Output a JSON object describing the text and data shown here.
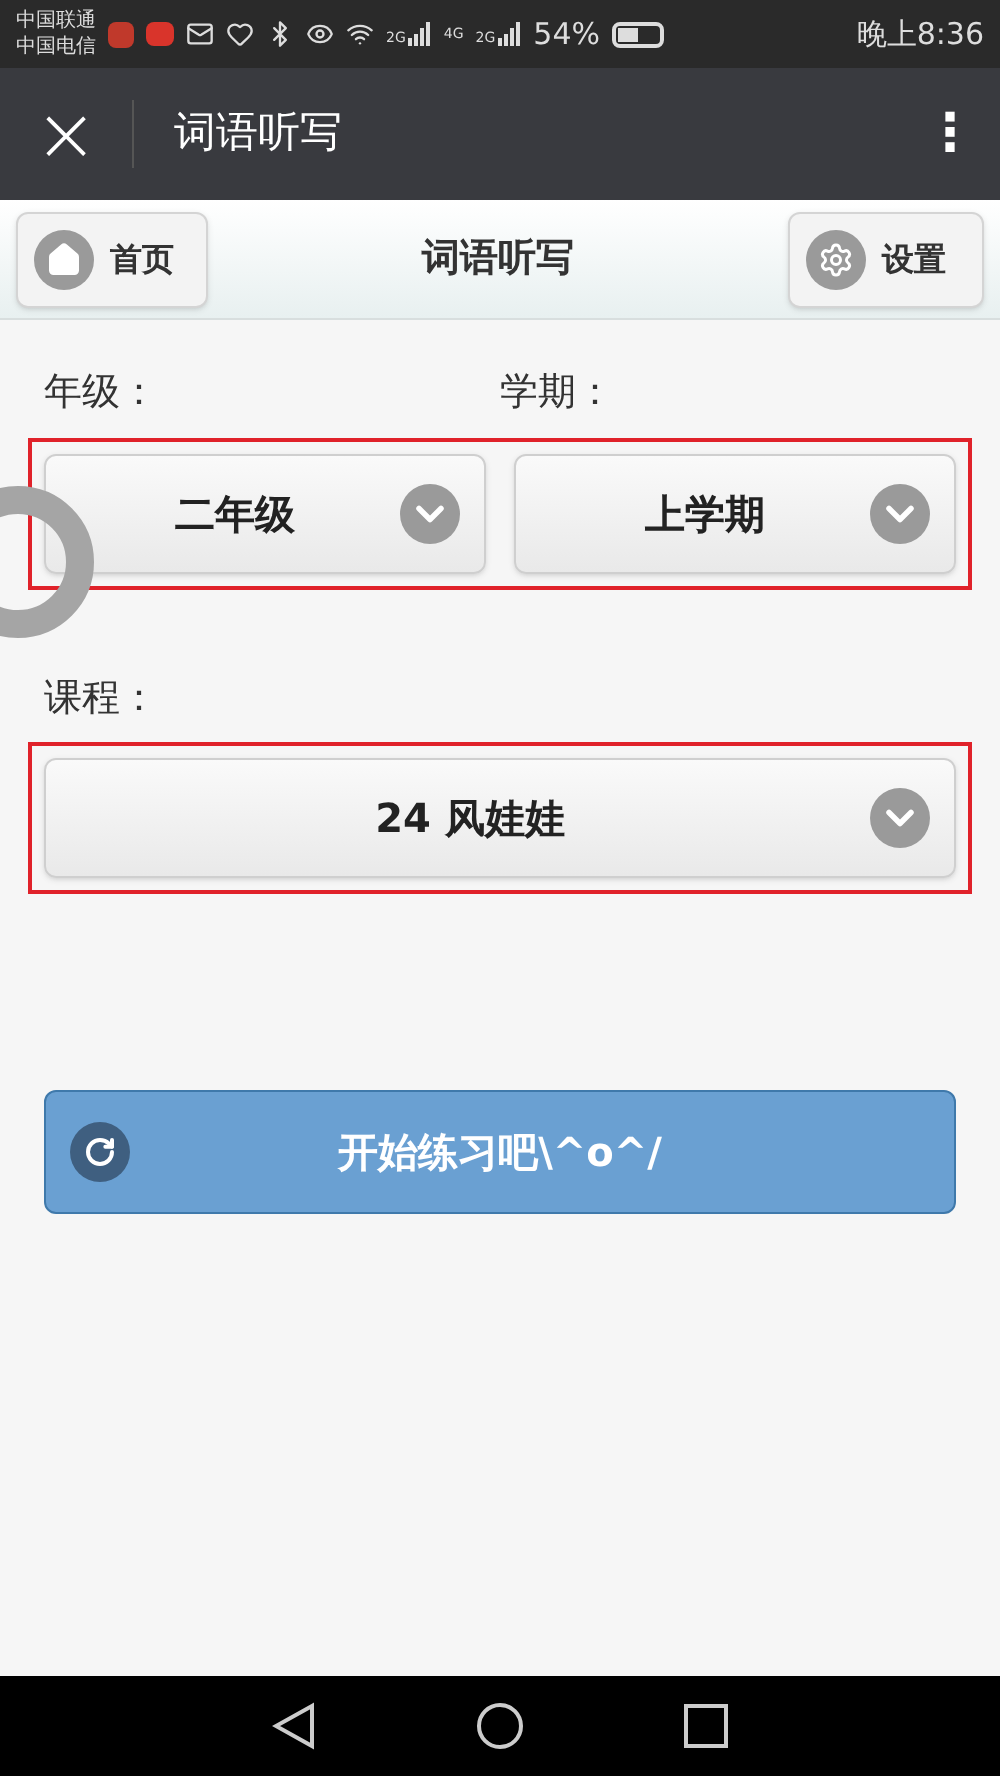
{
  "status_bar": {
    "carriers": [
      "中国联通",
      "中国电信"
    ],
    "network_labels": [
      "2G",
      "4G",
      "2G"
    ],
    "battery": "54%",
    "time": "晚上8:36"
  },
  "app_bar": {
    "close": "×",
    "title": "词语听写",
    "menu": "⋮"
  },
  "header": {
    "home": "首页",
    "title": "词语听写",
    "settings": "设置"
  },
  "groups": [
    {
      "highlighted": true,
      "fields": [
        {
          "label": "年级：",
          "value": "二年级"
        },
        {
          "label": "学期：",
          "value": "上学期"
        }
      ]
    },
    {
      "highlighted": true,
      "fields": [
        {
          "label": "课程：",
          "value": "24 风娃娃"
        }
      ]
    }
  ],
  "start_button": "开始练习吧\\^o^/"
}
